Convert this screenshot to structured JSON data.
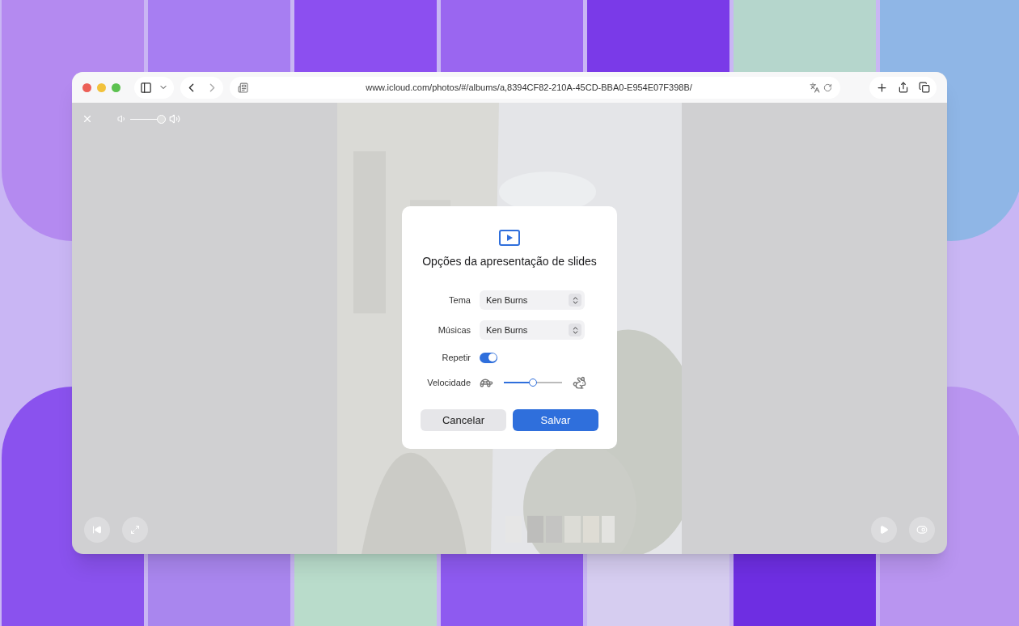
{
  "browser": {
    "url": "www.icloud.com/photos/#/albums/a,8394CF82-210A-45CD-BBA0-E954E07F398B/"
  },
  "player": {
    "volume": {
      "level": 1
    }
  },
  "dialog": {
    "title": "Opções da apresentação de slides",
    "fields": [
      {
        "kind": "select",
        "label": "Tema",
        "value": "Ken Burns"
      },
      {
        "kind": "select",
        "label": "Músicas",
        "value": "Ken Burns"
      },
      {
        "kind": "toggle",
        "label": "Repetir",
        "on": true
      },
      {
        "kind": "slider",
        "label": "Velocidade",
        "level": 0.5
      }
    ],
    "buttons": [
      {
        "label": "Cancelar",
        "primary": false
      },
      {
        "label": "Salvar",
        "primary": true
      }
    ]
  }
}
